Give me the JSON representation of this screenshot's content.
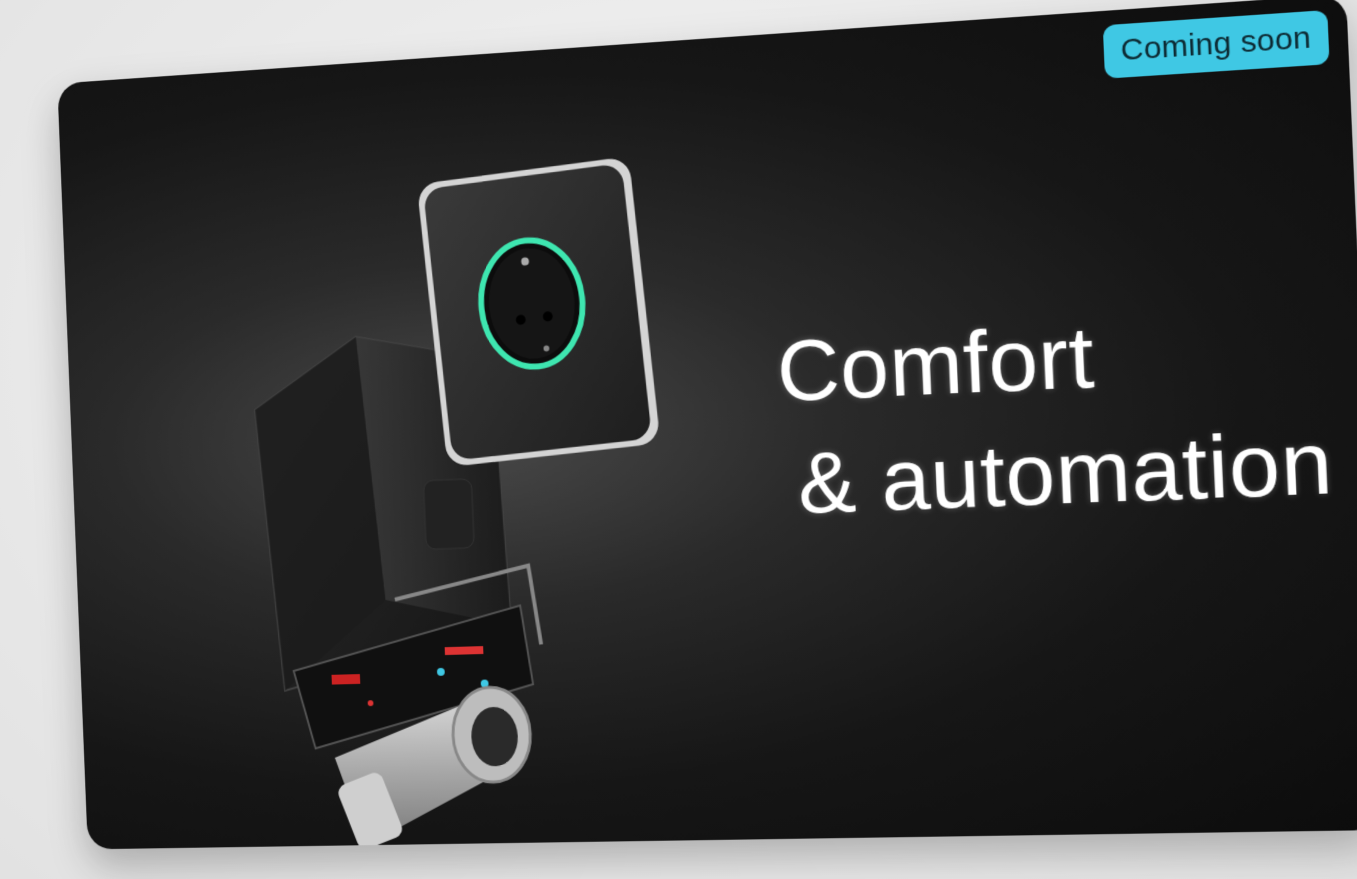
{
  "banner": {
    "badge": "Coming soon",
    "headline_line1": "Comfort",
    "headline_line2": "& automation"
  },
  "colors": {
    "card_background": "#141414",
    "badge_background": "#3fc8e4",
    "badge_text": "#0d2a33",
    "ring_accent": "#3ee6b0",
    "headline_text": "#ffffff"
  },
  "icons": {
    "product": "smart-valve-with-socket-icon"
  }
}
